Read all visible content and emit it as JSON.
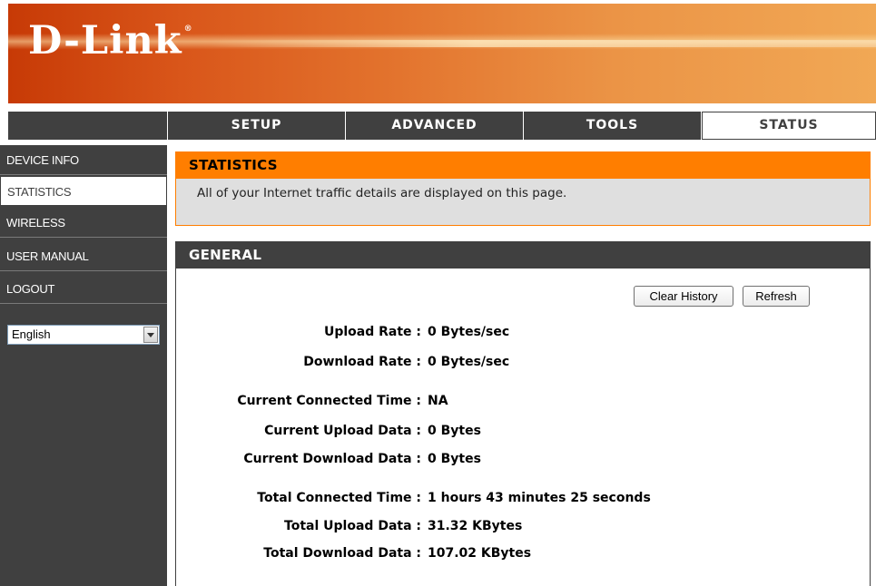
{
  "header": {
    "logo_text": "D-Link",
    "logo_mark": "®"
  },
  "nav": {
    "tabs": [
      {
        "label": "SETUP",
        "active": false
      },
      {
        "label": "ADVANCED",
        "active": false
      },
      {
        "label": "TOOLS",
        "active": false
      },
      {
        "label": "STATUS",
        "active": true
      }
    ]
  },
  "sidebar": {
    "items": [
      {
        "label": "DEVICE INFO",
        "active": false
      },
      {
        "label": "STATISTICS",
        "active": true
      },
      {
        "label": "WIRELESS",
        "active": false
      },
      {
        "label": "USER MANUAL",
        "active": false
      },
      {
        "label": "LOGOUT",
        "active": false
      }
    ],
    "language": {
      "selected": "English"
    }
  },
  "statistics": {
    "title": "STATISTICS",
    "description": "All of your Internet traffic details are displayed on this page."
  },
  "general": {
    "title": "GENERAL",
    "buttons": {
      "clear_history": "Clear History",
      "refresh": "Refresh"
    },
    "rows": [
      {
        "label": "Upload Rate :",
        "value": "0 Bytes/sec"
      },
      {
        "label": "Download Rate :",
        "value": "0 Bytes/sec"
      },
      {
        "label": "Current Connected Time :",
        "value": "NA"
      },
      {
        "label": "Current Upload Data :",
        "value": "0 Bytes"
      },
      {
        "label": "Current Download Data :",
        "value": "0 Bytes"
      },
      {
        "label": "Total Connected Time :",
        "value": "1 hours 43 minutes 25 seconds"
      },
      {
        "label": "Total Upload Data :",
        "value": "31.32 KBytes"
      },
      {
        "label": "Total Download Data :",
        "value": "107.02 KBytes"
      }
    ]
  },
  "colors": {
    "accent": "#ff7e00",
    "dark": "#404040",
    "banner": "#e3742e"
  }
}
